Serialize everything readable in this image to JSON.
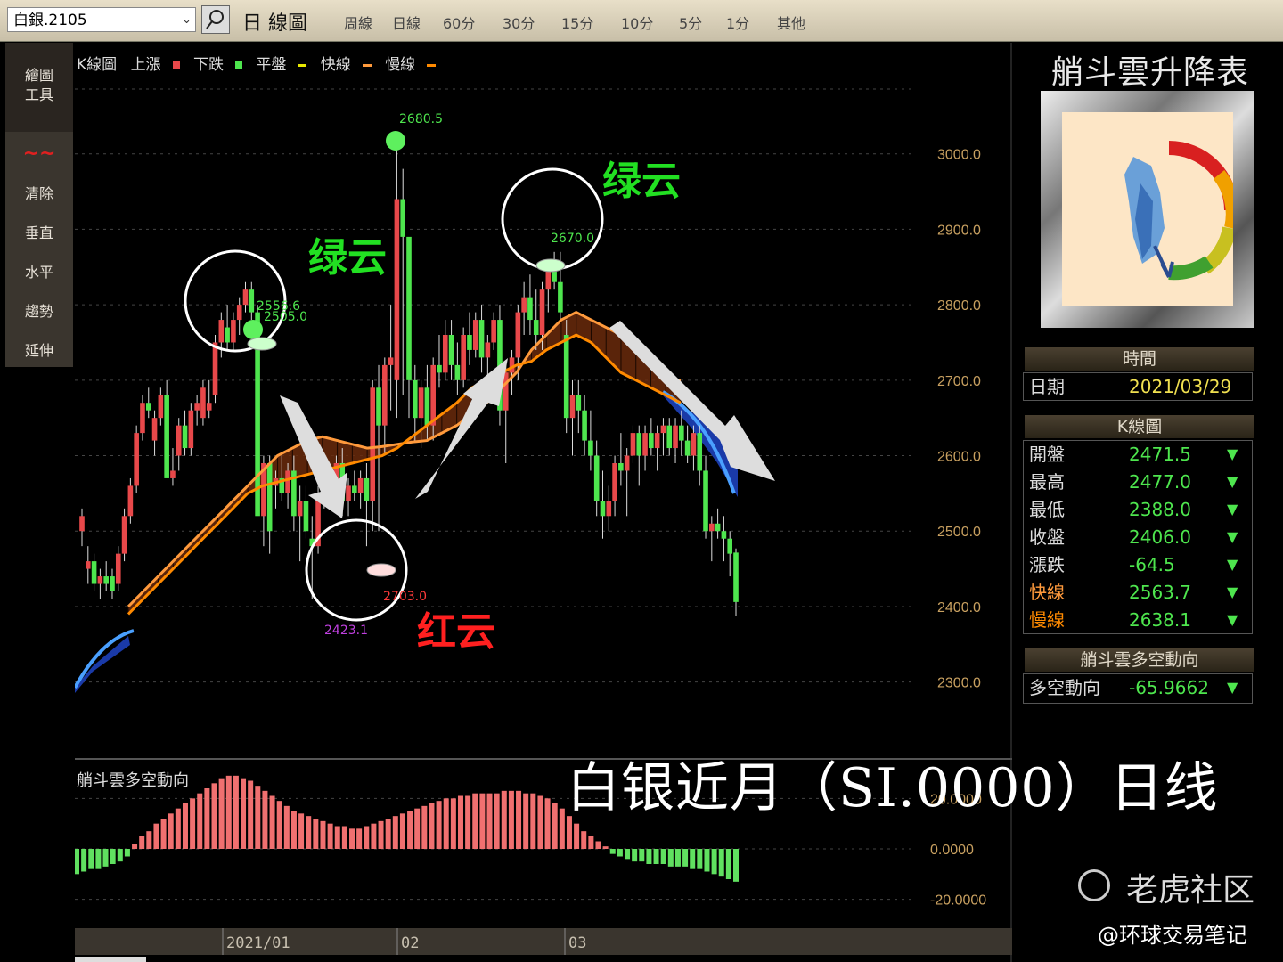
{
  "toolbar": {
    "symbol": "白銀.2105",
    "chart_title": "日 線圖",
    "periods": [
      "周線",
      "日線",
      "60分",
      "30分",
      "15分",
      "10分",
      "5分",
      "1分",
      "其他"
    ]
  },
  "sidebar": {
    "draw_tools": "繪圖\n工具",
    "items": [
      "清除",
      "垂直",
      "水平",
      "趨勢",
      "延伸"
    ]
  },
  "legend": {
    "title": "K線圖",
    "up": "上漲",
    "down": "下跌",
    "flat": "平盤",
    "fast": "快線",
    "slow": "慢線"
  },
  "colors": {
    "up": "#e8484a",
    "down": "#4ee64e",
    "fast": "#ff9a3c",
    "slow": "#ff8a00",
    "band": "#7a2a08"
  },
  "annotations": {
    "green_cloud_1": "绿云",
    "green_cloud_2": "绿云",
    "red_cloud": "红云",
    "high_label": "2680.5",
    "label_2556": "2556.6",
    "label_2505": "2505.0",
    "label_2670": "2670.0",
    "label_2703": "2703.0",
    "label_2423": "2423.1"
  },
  "osc_title": "艄斗雲多空動向",
  "x_labels": [
    "2021/01",
    "02",
    "03"
  ],
  "right_panel": {
    "title": "艄斗雲升降表",
    "time_header": "時間",
    "date_label": "日期",
    "date_value": "2021/03/29",
    "k_header": "K線圖",
    "rows": [
      {
        "k": "開盤",
        "v": "2471.5",
        "c": "#dddddd"
      },
      {
        "k": "最高",
        "v": "2477.0",
        "c": "#dddddd"
      },
      {
        "k": "最低",
        "v": "2388.0",
        "c": "#dddddd"
      },
      {
        "k": "收盤",
        "v": "2406.0",
        "c": "#dddddd"
      },
      {
        "k": "漲跌",
        "v": "-64.5",
        "c": "#dddddd"
      },
      {
        "k": "快線",
        "v": "2563.7",
        "c": "#ff9a3c"
      },
      {
        "k": "慢線",
        "v": "2638.1",
        "c": "#ff8a00"
      }
    ],
    "arrow": "▼",
    "trend_header": "艄斗雲多空動向",
    "trend_label": "多空動向",
    "trend_value": "-65.9662"
  },
  "overlay_title": "白银近月（SI.0000）日线",
  "watermark": {
    "brand": "老虎社区",
    "handle": "@环球交易笔记"
  },
  "chart_data": {
    "type": "candlestick",
    "ylim": [
      2250,
      3100
    ],
    "y_ticks": [
      3000,
      2900,
      2800,
      2700,
      2600,
      2500,
      2400,
      2300
    ],
    "y_tick_labels": [
      "3000.0",
      "2900.0",
      "2800.0",
      "2700.0",
      "2600.0",
      "2500.0",
      "2400.0",
      "2300.0"
    ],
    "candles": [
      [
        2500,
        2530,
        2480,
        2520
      ],
      [
        2450,
        2480,
        2430,
        2460
      ],
      [
        2460,
        2470,
        2420,
        2430
      ],
      [
        2430,
        2450,
        2410,
        2440
      ],
      [
        2440,
        2460,
        2420,
        2430
      ],
      [
        2440,
        2450,
        2410,
        2420
      ],
      [
        2430,
        2480,
        2420,
        2470
      ],
      [
        2470,
        2530,
        2460,
        2520
      ],
      [
        2520,
        2570,
        2510,
        2560
      ],
      [
        2560,
        2640,
        2550,
        2630
      ],
      [
        2630,
        2680,
        2620,
        2670
      ],
      [
        2670,
        2690,
        2650,
        2660
      ],
      [
        2620,
        2660,
        2600,
        2650
      ],
      [
        2650,
        2690,
        2640,
        2680
      ],
      [
        2680,
        2700,
        2650,
        2570
      ],
      [
        2570,
        2610,
        2560,
        2580
      ],
      [
        2600,
        2650,
        2580,
        2640
      ],
      [
        2640,
        2660,
        2600,
        2610
      ],
      [
        2610,
        2670,
        2600,
        2660
      ],
      [
        2660,
        2680,
        2640,
        2670
      ],
      [
        2650,
        2700,
        2640,
        2690
      ],
      [
        2660,
        2700,
        2650,
        2670
      ],
      [
        2680,
        2760,
        2670,
        2750
      ],
      [
        2750,
        2790,
        2730,
        2780
      ],
      [
        2770,
        2800,
        2740,
        2750
      ],
      [
        2750,
        2790,
        2740,
        2780
      ],
      [
        2780,
        2810,
        2760,
        2800
      ],
      [
        2800,
        2830,
        2790,
        2820
      ],
      [
        2820,
        2830,
        2780,
        2790
      ],
      [
        2790,
        2800,
        2600,
        2520
      ],
      [
        2520,
        2600,
        2480,
        2590
      ],
      [
        2590,
        2600,
        2470,
        2500
      ],
      [
        2560,
        2580,
        2530,
        2570
      ],
      [
        2570,
        2600,
        2540,
        2550
      ],
      [
        2550,
        2590,
        2530,
        2580
      ],
      [
        2580,
        2600,
        2500,
        2520
      ],
      [
        2520,
        2560,
        2460,
        2540
      ],
      [
        2540,
        2560,
        2490,
        2500
      ],
      [
        2490,
        2520,
        2410,
        2480
      ],
      [
        2480,
        2560,
        2470,
        2550
      ],
      [
        2550,
        2570,
        2530,
        2560
      ],
      [
        2560,
        2570,
        2540,
        2550
      ],
      [
        2550,
        2600,
        2540,
        2590
      ],
      [
        2590,
        2610,
        2520,
        2540
      ],
      [
        2540,
        2570,
        2520,
        2560
      ],
      [
        2560,
        2580,
        2540,
        2550
      ],
      [
        2550,
        2580,
        2530,
        2570
      ],
      [
        2570,
        2590,
        2480,
        2540
      ],
      [
        2540,
        2700,
        2500,
        2690
      ],
      [
        2690,
        2720,
        2500,
        2640
      ],
      [
        2640,
        2730,
        2600,
        2720
      ],
      [
        2720,
        2800,
        2660,
        2730
      ],
      [
        2700,
        3010,
        2650,
        2940
      ],
      [
        2940,
        2980,
        2680,
        2890
      ],
      [
        2890,
        2720,
        2650,
        2700
      ],
      [
        2700,
        2720,
        2620,
        2650
      ],
      [
        2650,
        2700,
        2610,
        2690
      ],
      [
        2690,
        2720,
        2620,
        2640
      ],
      [
        2640,
        2730,
        2620,
        2720
      ],
      [
        2720,
        2760,
        2690,
        2710
      ],
      [
        2710,
        2780,
        2700,
        2760
      ],
      [
        2760,
        2780,
        2700,
        2720
      ],
      [
        2720,
        2750,
        2680,
        2700
      ],
      [
        2700,
        2770,
        2690,
        2760
      ],
      [
        2760,
        2790,
        2720,
        2740
      ],
      [
        2740,
        2790,
        2730,
        2780
      ],
      [
        2780,
        2800,
        2710,
        2730
      ],
      [
        2730,
        2760,
        2700,
        2750
      ],
      [
        2750,
        2790,
        2740,
        2780
      ],
      [
        2780,
        2800,
        2640,
        2660
      ],
      [
        2660,
        2720,
        2590,
        2710
      ],
      [
        2710,
        2740,
        2680,
        2730
      ],
      [
        2730,
        2800,
        2700,
        2790
      ],
      [
        2790,
        2830,
        2760,
        2810
      ],
      [
        2810,
        2840,
        2760,
        2780
      ],
      [
        2780,
        2820,
        2740,
        2760
      ],
      [
        2760,
        2830,
        2740,
        2820
      ],
      [
        2820,
        2860,
        2790,
        2850
      ],
      [
        2850,
        2870,
        2820,
        2830
      ],
      [
        2830,
        2870,
        2780,
        2790
      ],
      [
        2760,
        2780,
        2630,
        2650
      ],
      [
        2650,
        2700,
        2600,
        2680
      ],
      [
        2680,
        2700,
        2630,
        2660
      ],
      [
        2660,
        2680,
        2600,
        2620
      ],
      [
        2620,
        2660,
        2580,
        2600
      ],
      [
        2600,
        2620,
        2520,
        2540
      ],
      [
        2540,
        2580,
        2490,
        2520
      ],
      [
        2520,
        2560,
        2500,
        2540
      ],
      [
        2540,
        2600,
        2520,
        2590
      ],
      [
        2590,
        2630,
        2560,
        2580
      ],
      [
        2580,
        2610,
        2520,
        2600
      ],
      [
        2600,
        2640,
        2590,
        2630
      ],
      [
        2630,
        2640,
        2560,
        2600
      ],
      [
        2600,
        2640,
        2580,
        2630
      ],
      [
        2630,
        2650,
        2600,
        2610
      ],
      [
        2610,
        2640,
        2580,
        2630
      ],
      [
        2630,
        2650,
        2600,
        2640
      ],
      [
        2640,
        2650,
        2600,
        2610
      ],
      [
        2610,
        2650,
        2590,
        2640
      ],
      [
        2640,
        2660,
        2600,
        2620
      ],
      [
        2620,
        2640,
        2590,
        2600
      ],
      [
        2600,
        2640,
        2580,
        2630
      ],
      [
        2630,
        2640,
        2560,
        2580
      ],
      [
        2580,
        2600,
        2490,
        2500
      ],
      [
        2500,
        2520,
        2460,
        2510
      ],
      [
        2510,
        2530,
        2490,
        2500
      ],
      [
        2500,
        2520,
        2460,
        2490
      ],
      [
        2490,
        2500,
        2440,
        2470
      ],
      [
        2471.5,
        2477,
        2388,
        2406
      ]
    ],
    "fast_line": [
      2400,
      2420,
      2440,
      2460,
      2480,
      2500,
      2520,
      2540,
      2560,
      2580,
      2600,
      2610,
      2620,
      2625,
      2620,
      2615,
      2610,
      2612,
      2615,
      2618,
      2620,
      2630,
      2640,
      2655,
      2670,
      2690,
      2710,
      2740,
      2760,
      2780,
      2790,
      2780,
      2770,
      2760,
      2740,
      2720,
      2700,
      2700
    ],
    "slow_line": [
      2390,
      2410,
      2430,
      2450,
      2470,
      2490,
      2510,
      2530,
      2550,
      2560,
      2565,
      2570,
      2575,
      2580,
      2585,
      2590,
      2595,
      2600,
      2610,
      2625,
      2640,
      2655,
      2670,
      2690,
      2700,
      2710,
      2720,
      2725,
      2740,
      2750,
      2760,
      2750,
      2730,
      2710,
      2700,
      2690,
      2680,
      2670
    ],
    "oscillator": {
      "ylim": [
        -30,
        30
      ],
      "y_ticks": [
        20,
        0,
        -20
      ],
      "y_tick_labels": [
        "20.0000",
        "0.0000",
        "-20.0000"
      ],
      "values": [
        -10,
        -9,
        -8,
        -8,
        -7,
        -6,
        -5,
        -3,
        2,
        5,
        7,
        10,
        12,
        14,
        16,
        18,
        20,
        22,
        24,
        26,
        28,
        29,
        29,
        28,
        27,
        25,
        23,
        21,
        19,
        17,
        15,
        14,
        13,
        12,
        11,
        10,
        9,
        9,
        8,
        8,
        9,
        10,
        11,
        12,
        13,
        14,
        15,
        16,
        17,
        18,
        19,
        20,
        20,
        21,
        21,
        22,
        22,
        22,
        22,
        23,
        23,
        23,
        22,
        22,
        21,
        20,
        18,
        16,
        13,
        10,
        7,
        5,
        3,
        1,
        -2,
        -3,
        -4,
        -5,
        -5,
        -6,
        -6,
        -6,
        -7,
        -7,
        -7,
        -8,
        -8,
        -9,
        -10,
        -11,
        -12,
        -13
      ]
    }
  }
}
